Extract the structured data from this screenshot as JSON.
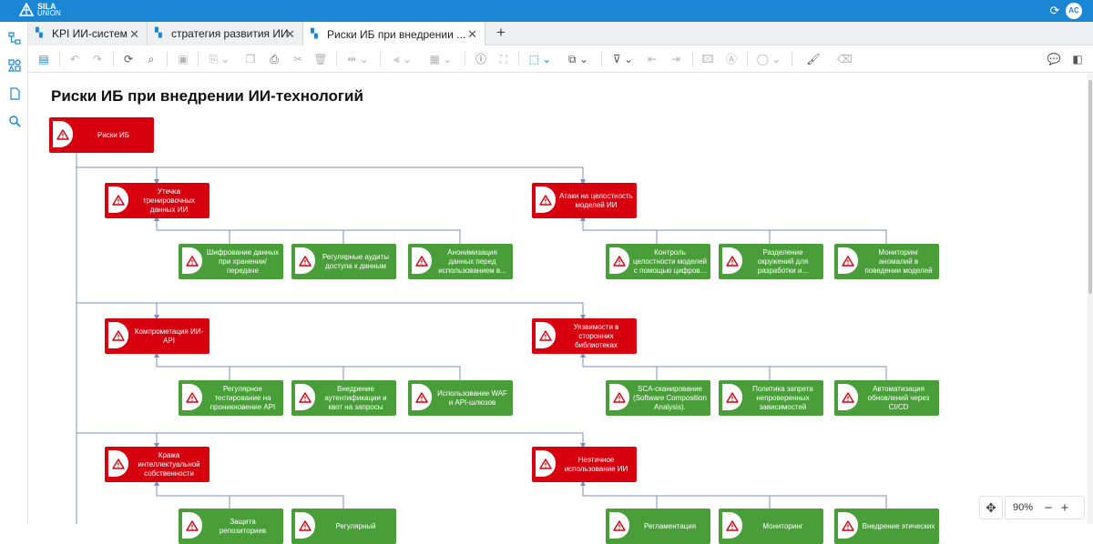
{
  "app": {
    "logo_name": "SILA",
    "logo_sub": "UNION",
    "user_initials": "AC"
  },
  "tabs": [
    {
      "label": "KPI ИИ-систем"
    },
    {
      "label": "стратегия развития ИИ"
    },
    {
      "label": "Риски ИБ при внедрении ..."
    }
  ],
  "diagram": {
    "title": "Риски ИБ при внедрении ИИ-технологий",
    "root": "Риски ИБ",
    "nodes": [
      {
        "id": "n1",
        "label": "Утечка тренировочных данных ИИ",
        "color": "red"
      },
      {
        "id": "n2",
        "label": "Атаки на целостность моделей ИИ",
        "color": "red"
      },
      {
        "id": "n1a",
        "label": "Шифрование данных при хранении/передаче",
        "color": "green"
      },
      {
        "id": "n1b",
        "label": "Регулярные аудиты доступа к данным",
        "color": "green"
      },
      {
        "id": "n1c",
        "label": "Анонимизация данных перед использованием в...",
        "color": "green"
      },
      {
        "id": "n2a",
        "label": "Контроль целостности моделей с помощью цифров...",
        "color": "green"
      },
      {
        "id": "n2b",
        "label": "Разделение окружений для разработки и...",
        "color": "green"
      },
      {
        "id": "n2c",
        "label": "Мониторинг аномалий в поведении моделей",
        "color": "green"
      },
      {
        "id": "n3",
        "label": "Компрометация ИИ-API",
        "color": "red"
      },
      {
        "id": "n4",
        "label": "Уязвимости в сторонних библиотеках",
        "color": "red"
      },
      {
        "id": "n3a",
        "label": "Регулярное тестирование на проникновение API",
        "color": "green"
      },
      {
        "id": "n3b",
        "label": "Внедрение аутентификации и квот на запросы",
        "color": "green"
      },
      {
        "id": "n3c",
        "label": "Использование WAF и API-шлюзов",
        "color": "green"
      },
      {
        "id": "n4a",
        "label": "SCA-сканирование (Software Composition Analysis).",
        "color": "green"
      },
      {
        "id": "n4b",
        "label": "Политика запрета непроверенных зависимостей",
        "color": "green"
      },
      {
        "id": "n4c",
        "label": "Автоматизация обновлений через CI/CD",
        "color": "green"
      },
      {
        "id": "n5",
        "label": "Кража интеллектуальной собственности",
        "color": "red"
      },
      {
        "id": "n6",
        "label": "Неэтичное использование ИИ",
        "color": "red"
      },
      {
        "id": "n5a",
        "label": "Защита репозиториев",
        "color": "green"
      },
      {
        "id": "n5b",
        "label": "Регулярный",
        "color": "green"
      },
      {
        "id": "n6a",
        "label": "Регламентация",
        "color": "green"
      },
      {
        "id": "n6b",
        "label": "Мониторинг",
        "color": "green"
      },
      {
        "id": "n6c",
        "label": "Внедрение этических",
        "color": "green"
      }
    ]
  },
  "zoom": {
    "value": "90%",
    "minus": "−",
    "plus": "+"
  },
  "colors": {
    "accent": "#1a86d4",
    "risk": "#d7000f",
    "measure": "#4a9e39",
    "connector": "#7a8fc0"
  }
}
